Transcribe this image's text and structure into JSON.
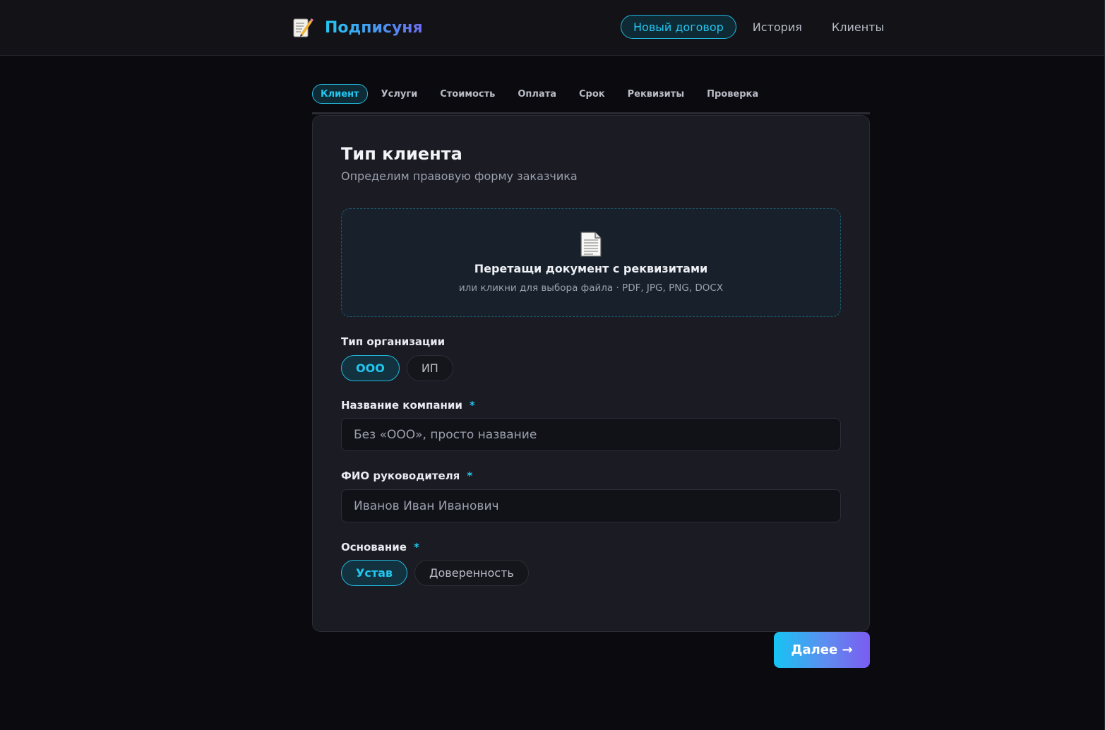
{
  "header": {
    "logo_icon": "memo-pencil-icon",
    "title": "Подписуня",
    "nav": [
      {
        "label": "Новый договор",
        "active": true
      },
      {
        "label": "История",
        "active": false
      },
      {
        "label": "Клиенты",
        "active": false
      }
    ]
  },
  "steps": [
    {
      "label": "Клиент",
      "active": true
    },
    {
      "label": "Услуги",
      "active": false
    },
    {
      "label": "Стоимость",
      "active": false
    },
    {
      "label": "Оплата",
      "active": false
    },
    {
      "label": "Срок",
      "active": false
    },
    {
      "label": "Реквизиты",
      "active": false
    },
    {
      "label": "Проверка",
      "active": false
    }
  ],
  "card": {
    "title": "Тип клиента",
    "subtitle": "Определим правовую форму заказчика"
  },
  "dropzone": {
    "icon": "document-icon",
    "title": "Перетащи документ с реквизитами",
    "subtitle": "или кликни для выбора файла · PDF, JPG, PNG, DOCX"
  },
  "org_type": {
    "label": "Тип организации",
    "options": [
      {
        "label": "ООО",
        "selected": true
      },
      {
        "label": "ИП",
        "selected": false
      }
    ]
  },
  "company_name": {
    "label": "Название компании",
    "required_mark": "*",
    "value": "",
    "placeholder": "Без «ООО», просто название"
  },
  "director_name": {
    "label": "ФИО руководителя",
    "required_mark": "*",
    "value": "",
    "placeholder": "Иванов Иван Иванович"
  },
  "basis": {
    "label": "Основание",
    "required_mark": "*",
    "options": [
      {
        "label": "Устав",
        "selected": true
      },
      {
        "label": "Доверенность",
        "selected": false
      }
    ]
  },
  "next_button": "Далее →",
  "colors": {
    "accent": "#22c7f0",
    "accent_violet": "#7a5cf0",
    "background": "#0b0b0f",
    "card": "#1a1b23"
  }
}
